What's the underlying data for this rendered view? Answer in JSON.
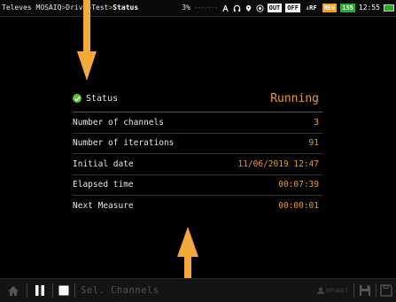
{
  "statusbar": {
    "title_part1": "Televes MOSAIQ",
    "title_part2": "Drive",
    "title_hidden": "Test",
    "title_part3": "Status",
    "battery_pct": "3%",
    "badges": {
      "out": "OUT",
      "off": "OFF",
      "rf": "↓RF",
      "db1": "REG",
      "db2": "155"
    },
    "clock": "12:55"
  },
  "panel": {
    "status_label": "Status",
    "status_value": "Running",
    "rows": [
      {
        "label": "Number of channels",
        "value": "3"
      },
      {
        "label": "Number of iterations",
        "value": "91"
      },
      {
        "label": "Initial date",
        "value": "11/06/2019 12:47"
      },
      {
        "label": "Elapsed time",
        "value": "00:07:39"
      },
      {
        "label": "Next Measure",
        "value": "00:00:01"
      }
    ]
  },
  "bottombar": {
    "sel_channels": "Sel. Channels",
    "default_label": "DEFAULT"
  },
  "colors": {
    "accent": "#e89a2a",
    "arrow": "#f5a83a",
    "check": "#5fbf3a",
    "background": "#000000"
  }
}
